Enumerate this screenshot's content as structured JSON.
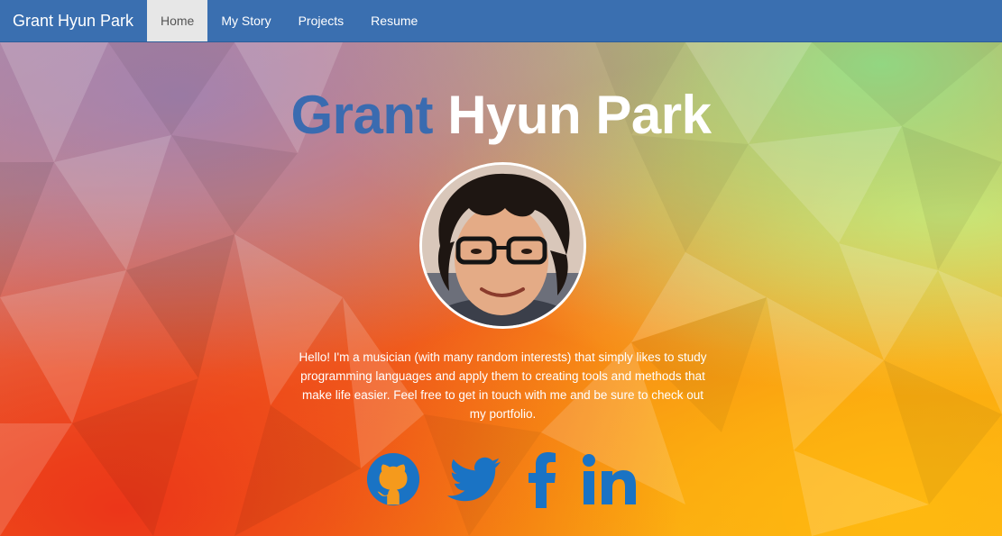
{
  "navbar": {
    "brand": "Grant Hyun Park",
    "items": [
      {
        "label": "Home",
        "active": true
      },
      {
        "label": "My Story",
        "active": false
      },
      {
        "label": "Projects",
        "active": false
      },
      {
        "label": "Resume",
        "active": false
      }
    ]
  },
  "hero": {
    "title_first": "Grant",
    "title_rest": "Hyun Park",
    "bio": "Hello! I'm a musician (with many random interests) that simply likes to study programming languages and apply them to creating tools and methods that make life easier. Feel free to get in touch with me and be sure to check out my portfolio."
  },
  "social": [
    {
      "icon": "github-icon"
    },
    {
      "icon": "twitter-icon"
    },
    {
      "icon": "facebook-icon"
    },
    {
      "icon": "linkedin-icon"
    }
  ],
  "colors": {
    "navbar": "#3a6fb0",
    "active_tab": "#e7e7e7",
    "title_accent": "#3a6bb0",
    "social_icons": "#1a73c4"
  }
}
